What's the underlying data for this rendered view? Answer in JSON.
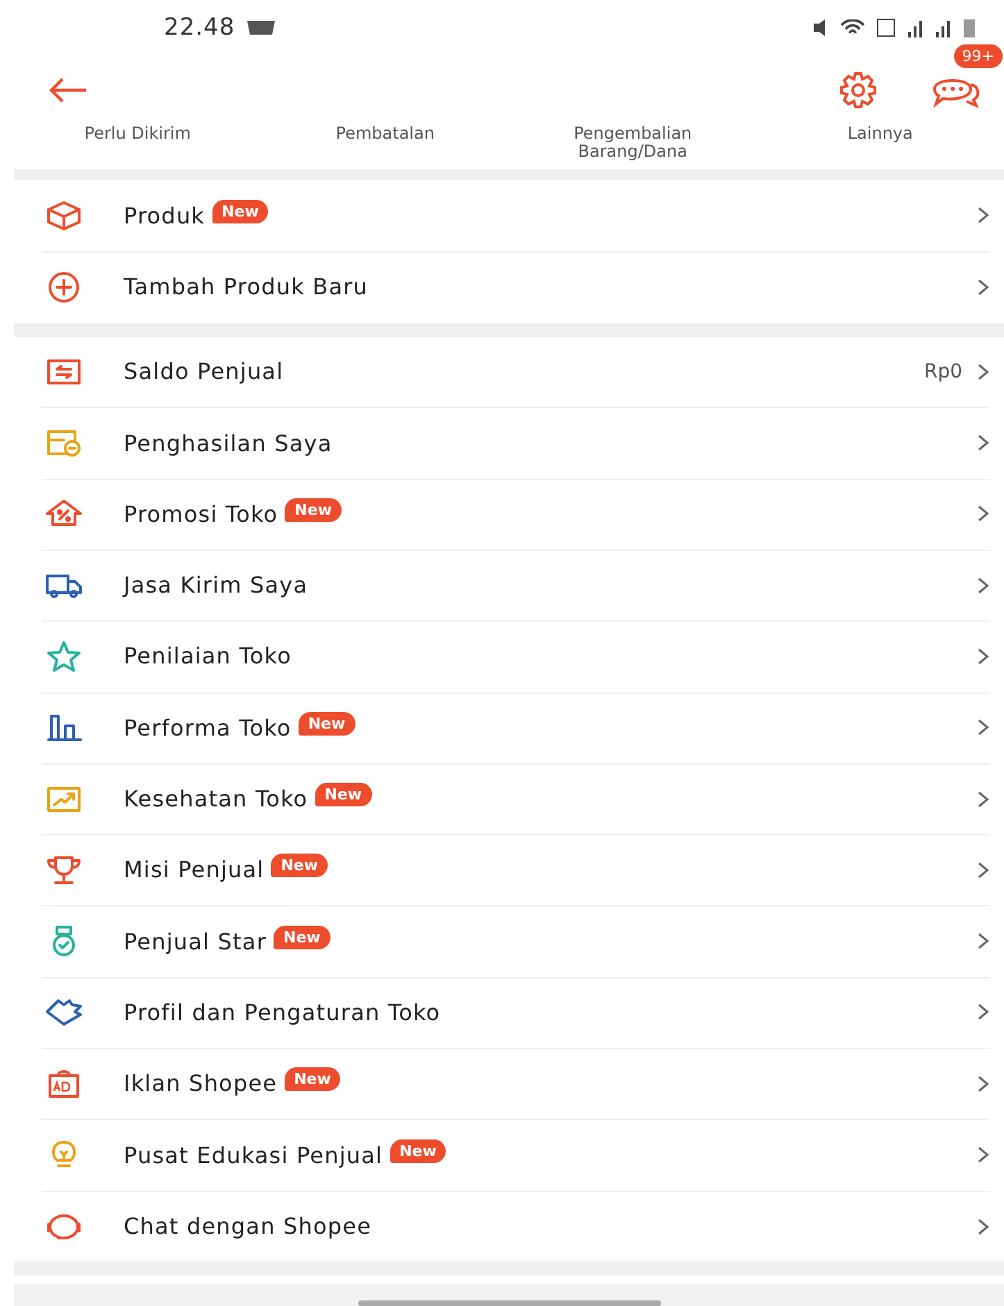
{
  "status_bar": {
    "time": "22.48"
  },
  "header": {
    "chat_badge": "99+"
  },
  "order_tabs": [
    "Perlu Dikirim",
    "Pembatalan",
    "Pengembalian Barang/Dana",
    "Lainnya"
  ],
  "sections": [
    {
      "items": [
        {
          "label": "Produk",
          "badge": "New"
        },
        {
          "label": "Tambah Produk Baru"
        }
      ]
    },
    {
      "items": [
        {
          "label": "Saldo Penjual",
          "value": "Rp0"
        },
        {
          "label": "Penghasilan Saya"
        },
        {
          "label": "Promosi Toko",
          "badge": "New"
        },
        {
          "label": "Jasa Kirim Saya"
        },
        {
          "label": "Penilaian Toko"
        },
        {
          "label": "Performa Toko",
          "badge": "New"
        },
        {
          "label": "Kesehatan Toko",
          "badge": "New"
        },
        {
          "label": "Misi Penjual",
          "badge": "New"
        },
        {
          "label": "Penjual Star",
          "badge": "New"
        },
        {
          "label": "Profil dan Pengaturan Toko"
        },
        {
          "label": "Iklan Shopee",
          "badge": "New"
        },
        {
          "label": "Pusat Edukasi Penjual",
          "badge": "New"
        },
        {
          "label": "Chat dengan Shopee"
        }
      ]
    }
  ]
}
